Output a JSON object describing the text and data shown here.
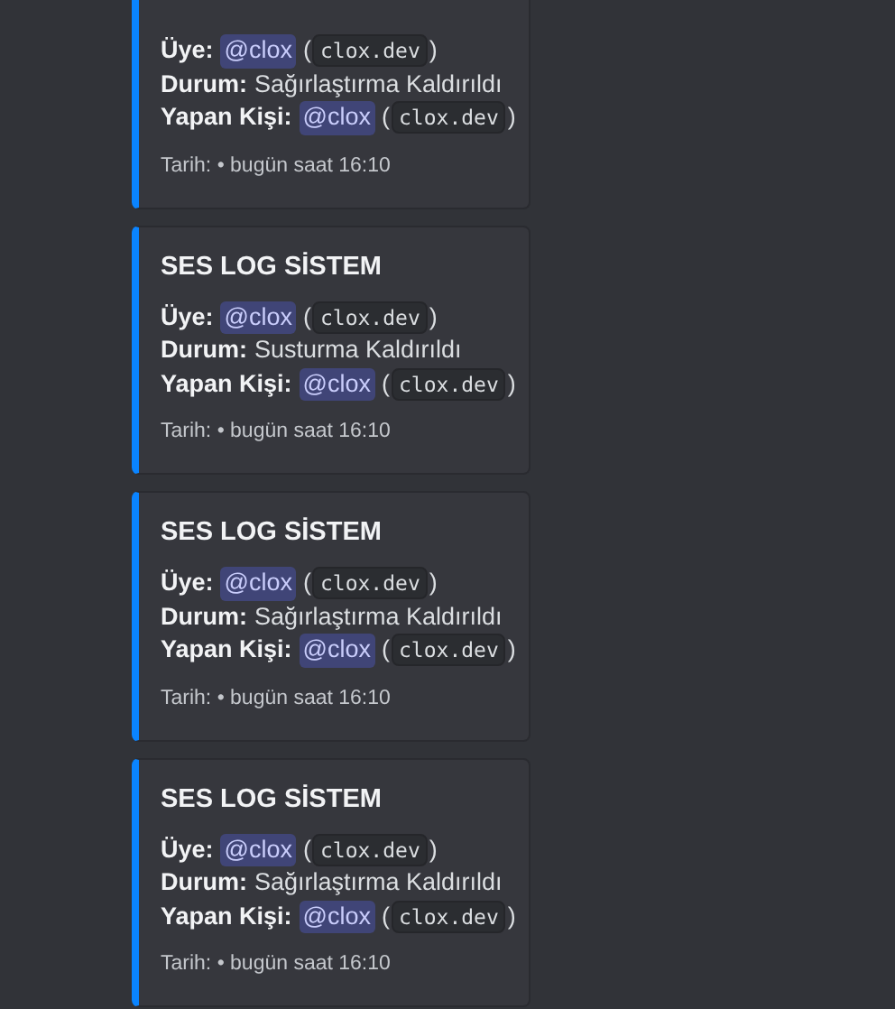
{
  "embeds": [
    {
      "color": "#0a84ff",
      "fields": [
        {
          "kind": "user",
          "label": "Üye:",
          "mention": "@clox",
          "open": "(",
          "code": "clox.dev",
          "close": ")"
        },
        {
          "kind": "text",
          "label": "Durum:",
          "value": "Sağırlaştırma Kaldırıldı"
        },
        {
          "kind": "user",
          "label": "Yapan Kişi:",
          "mention": "@clox",
          "open": "(",
          "code": "clox.dev",
          "close": ")"
        }
      ],
      "footer": "Tarih: • bugün saat 16:10"
    },
    {
      "color": "#0a84ff",
      "title": "SES LOG SİSTEM",
      "fields": [
        {
          "kind": "user",
          "label": "Üye:",
          "mention": "@clox",
          "open": "(",
          "code": "clox.dev",
          "close": ")"
        },
        {
          "kind": "text",
          "label": "Durum:",
          "value": "Susturma Kaldırıldı"
        },
        {
          "kind": "user",
          "label": "Yapan Kişi:",
          "mention": "@clox",
          "open": "(",
          "code": "clox.dev",
          "close": ")"
        }
      ],
      "footer": "Tarih: • bugün saat 16:10"
    },
    {
      "color": "#0a84ff",
      "title": "SES LOG SİSTEM",
      "fields": [
        {
          "kind": "user",
          "label": "Üye:",
          "mention": "@clox",
          "open": "(",
          "code": "clox.dev",
          "close": ")"
        },
        {
          "kind": "text",
          "label": "Durum:",
          "value": "Sağırlaştırma Kaldırıldı"
        },
        {
          "kind": "user",
          "label": "Yapan Kişi:",
          "mention": "@clox",
          "open": "(",
          "code": "clox.dev",
          "close": ")"
        }
      ],
      "footer": "Tarih: • bugün saat 16:10"
    },
    {
      "color": "#0a84ff",
      "title": "SES LOG SİSTEM",
      "fields": [
        {
          "kind": "user",
          "label": "Üye:",
          "mention": "@clox",
          "open": "(",
          "code": "clox.dev",
          "close": ")"
        },
        {
          "kind": "text",
          "label": "Durum:",
          "value": "Sağırlaştırma Kaldırıldı"
        },
        {
          "kind": "user",
          "label": "Yapan Kişi:",
          "mention": "@clox",
          "open": "(",
          "code": "clox.dev",
          "close": ")"
        }
      ],
      "footer": "Tarih: • bugün saat 16:10"
    }
  ]
}
